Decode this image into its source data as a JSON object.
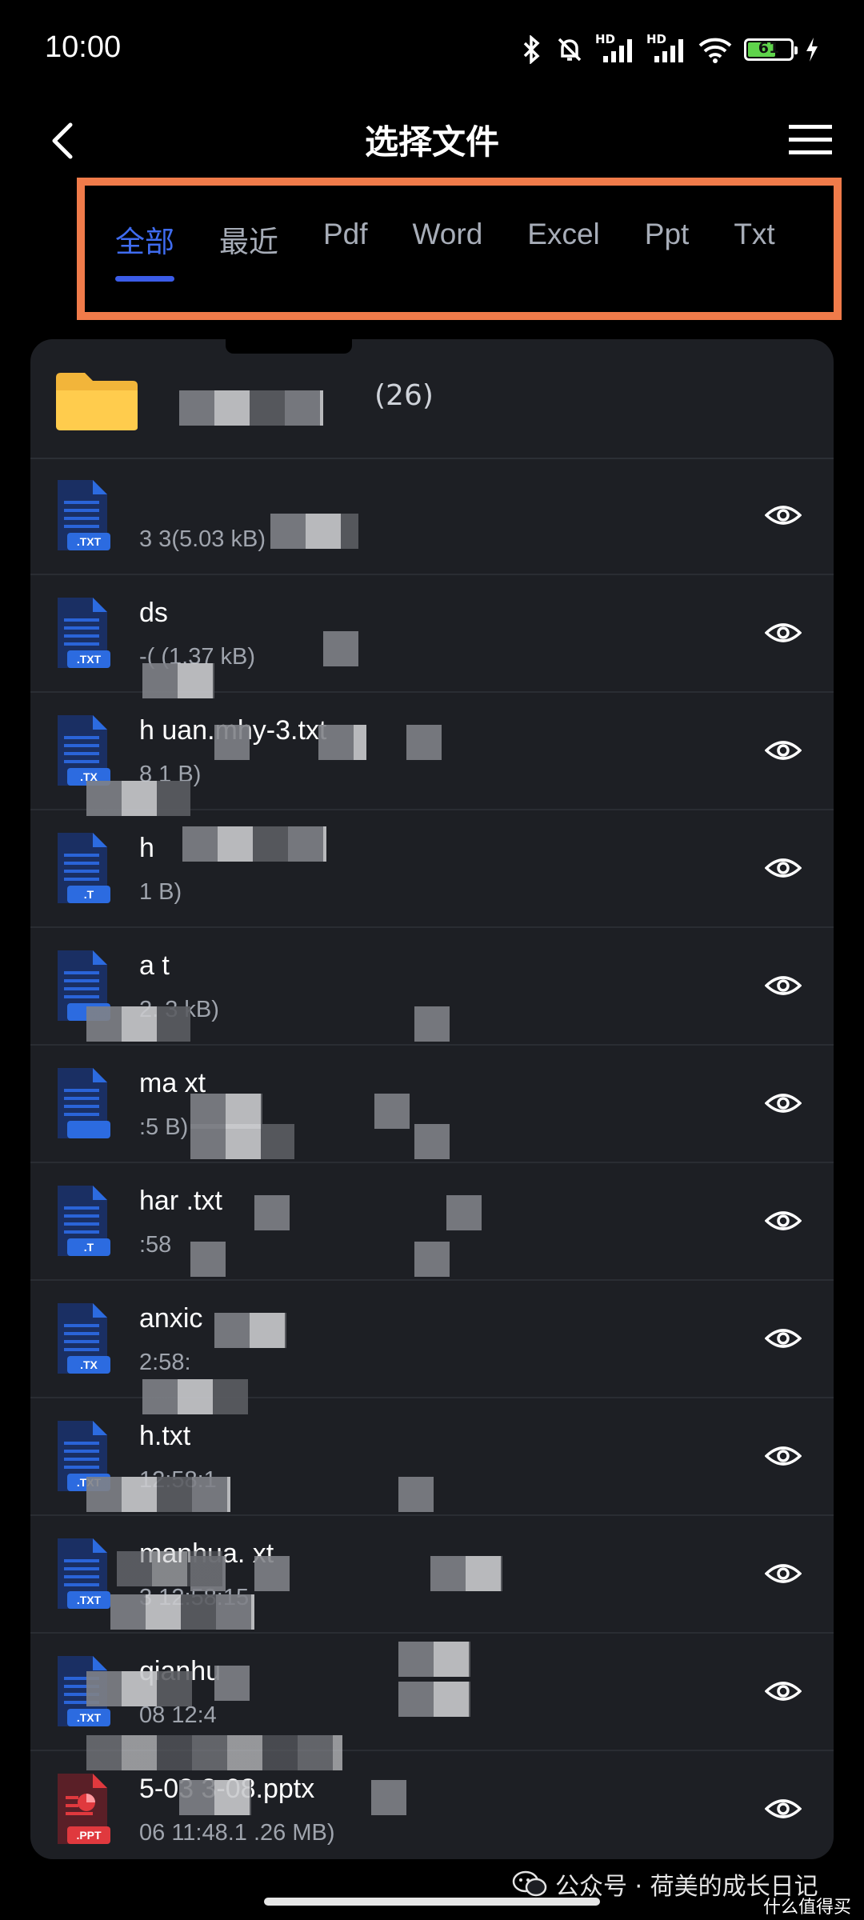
{
  "status": {
    "time": "10:00",
    "battery": "61",
    "net1": "HD",
    "net2": "HD"
  },
  "header": {
    "title": "选择文件"
  },
  "tabs": [
    {
      "label": "全部",
      "active": true
    },
    {
      "label": "最近",
      "active": false
    },
    {
      "label": "Pdf",
      "active": false
    },
    {
      "label": "Word",
      "active": false
    },
    {
      "label": "Excel",
      "active": false
    },
    {
      "label": "Ppt",
      "active": false
    },
    {
      "label": "Txt",
      "active": false
    }
  ],
  "folder": {
    "count": "(26)"
  },
  "files": [
    {
      "name": "",
      "meta": "3            3(5.03 kB)",
      "badge": ".TXT",
      "type": "txt"
    },
    {
      "name": "ds",
      "meta": "-(            (1.37 kB)",
      "badge": ".TXT",
      "type": "txt"
    },
    {
      "name": "h              uan.mhy-3.txt",
      "meta": "8            1 B)",
      "badge": ".TX",
      "type": "txt"
    },
    {
      "name": "h",
      "meta": "1               B)",
      "badge": ".T",
      "type": "txt"
    },
    {
      "name": "a           t",
      "meta": "2.          3 kB)",
      "badge": "",
      "type": "txt"
    },
    {
      "name": "ma           xt",
      "meta": ":5            B)",
      "badge": "",
      "type": "txt"
    },
    {
      "name": "har           .txt",
      "meta": ":58",
      "badge": ".T",
      "type": "txt"
    },
    {
      "name": "anxic",
      "meta": "2:58:",
      "badge": ".TX",
      "type": "txt"
    },
    {
      "name": "h.txt",
      "meta": "12:58:1",
      "badge": ".TXT",
      "type": "txt"
    },
    {
      "name": "manhua.           xt",
      "meta": "3 12:58:15",
      "badge": ".TXT",
      "type": "txt"
    },
    {
      "name": "qianhu",
      "meta": "08 12:4",
      "badge": ".TXT",
      "type": "txt"
    },
    {
      "name": "5-03           3-08.pptx",
      "meta": "06 11:48.1     .26 MB)",
      "badge": ".PPT",
      "type": "ppt"
    }
  ],
  "watermark": {
    "text": "公众号 · 荷美的成长日记",
    "sub": "什么值得买"
  },
  "colors": {
    "accent": "#3f6cf0",
    "highlight": "#f07b4a",
    "panel": "#1d1f24",
    "txt_icon": "#2c6be0",
    "ppt_icon": "#e0393e"
  }
}
